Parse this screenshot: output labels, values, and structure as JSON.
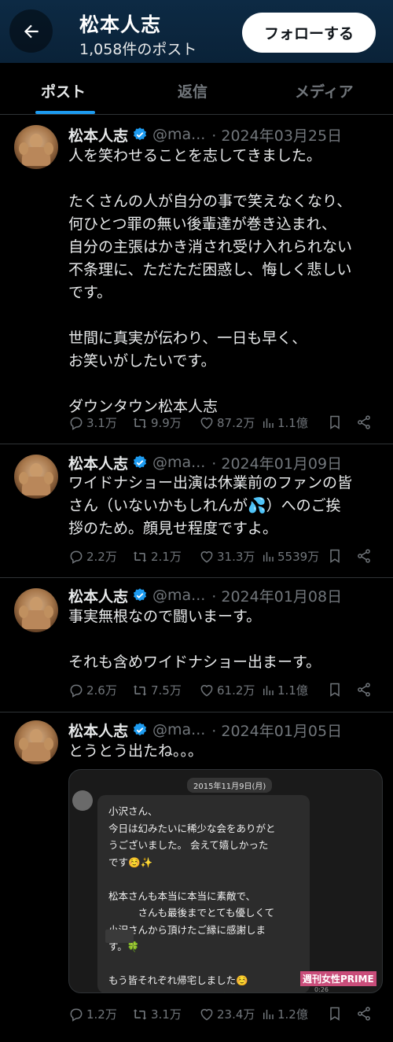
{
  "header": {
    "name": "松本人志",
    "post_count": "1,058件のポスト",
    "follow_label": "フォローする"
  },
  "tabs": [
    {
      "label": "ポスト",
      "active": true
    },
    {
      "label": "返信",
      "active": false
    },
    {
      "label": "メディア",
      "active": false
    }
  ],
  "colors": {
    "accent": "#1d9bf0",
    "header_bg": "#0d2a44",
    "muted": "#71767b"
  },
  "tweets": [
    {
      "name": "松本人志",
      "handle": "@ma...",
      "date": "· 2024年03月25日",
      "text": "人を笑わせることを志してきました。\n\nたくさんの人が自分の事で笑えなくなり、\n何ひとつ罪の無い後輩達が巻き込まれ、\n自分の主張はかき消され受け入れられない\n不条理に、ただただ困惑し、悔しく悲しい\nです。\n\n世間に真実が伝わり、一日も早く、\nお笑いがしたいです。\n\nダウンタウン松本人志",
      "replies": "3.1万",
      "retweets": "9.9万",
      "likes": "87.2万",
      "views": "1.1億"
    },
    {
      "name": "松本人志",
      "handle": "@ma...",
      "date": "· 2024年01月09日",
      "text": "ワイドナショー出演は休業前のファンの皆\nさん（いないかもしれんが💦）へのご挨\n拶のため。顔見せ程度ですよ。",
      "replies": "2.2万",
      "retweets": "2.1万",
      "likes": "31.3万",
      "views": "5539万"
    },
    {
      "name": "松本人志",
      "handle": "@ma...",
      "date": "· 2024年01月08日",
      "text": "事実無根なので闘いまーす。\n\nそれも含めワイドナショー出まーす。",
      "replies": "2.6万",
      "retweets": "7.5万",
      "likes": "61.2万",
      "views": "1.1億"
    },
    {
      "name": "松本人志",
      "handle": "@ma...",
      "date": "· 2024年01月05日",
      "text": "とうとう出たね。。。",
      "replies": "1.2万",
      "retweets": "3.1万",
      "likes": "23.4万",
      "views": "1.2億"
    }
  ],
  "media": {
    "date_label": "2015年11月9日(月)",
    "message": "小沢さん、\n今日は幻みたいに稀少な会をありがと\nうございました。 会えて嬉しかった\nです☺️✨\n\n松本さんも本当に本当に素敵で、\n　　　さんも最後までとても優しくて\n小沢さんから頂けたご縁に感謝しま\nす。🍀\n\nもう皆それぞれ帰宅しました☺️\nありがとうございました🍀🐈",
    "watermark": "週刊女性PRIME",
    "time": "0:26"
  }
}
